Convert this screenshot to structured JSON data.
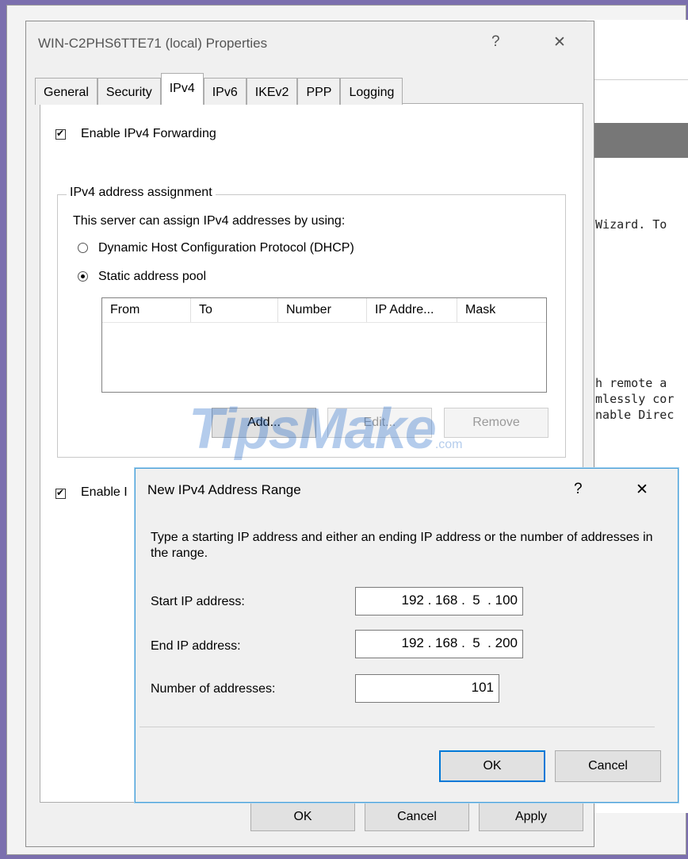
{
  "background_window": {
    "line1": " Wizard. To",
    "line2": "ch remote a",
    "line3": "amlessly cor",
    "line4": "Enable Direc"
  },
  "properties": {
    "title": "WIN-C2PHS6TTE71 (local) Properties",
    "help": "?",
    "close": "✕",
    "tabs": [
      "General",
      "Security",
      "IPv4",
      "IPv6",
      "IKEv2",
      "PPP",
      "Logging"
    ],
    "enable_forwarding": "Enable IPv4 Forwarding",
    "group_title": "IPv4 address assignment",
    "group_desc": "This server can assign IPv4 addresses by using:",
    "option_dhcp": "Dynamic Host Configuration Protocol (DHCP)",
    "option_static": "Static address pool",
    "columns": [
      "From",
      "To",
      "Number",
      "IP Addre...",
      "Mask"
    ],
    "add": "Add...",
    "edit": "Edit...",
    "remove": "Remove",
    "enable_second": "Enable I",
    "ok": "OK",
    "cancel": "Cancel",
    "apply": "Apply"
  },
  "watermark": {
    "text": "TipsMake",
    "suffix": ".com"
  },
  "range_dialog": {
    "title": "New IPv4 Address Range",
    "help": "?",
    "close": "✕",
    "instructions": "Type a starting IP address and either an ending IP address or the number of addresses in the range.",
    "start_label": "Start IP address:",
    "start_value": "192 . 168 .  5  . 100",
    "end_label": "End IP address:",
    "end_value": "192 . 168 .  5  . 200",
    "count_label": "Number of addresses:",
    "count_value": "101",
    "ok": "OK",
    "cancel": "Cancel"
  },
  "colors": {
    "accent": "#0078d7",
    "frame": "#7b6fae"
  }
}
